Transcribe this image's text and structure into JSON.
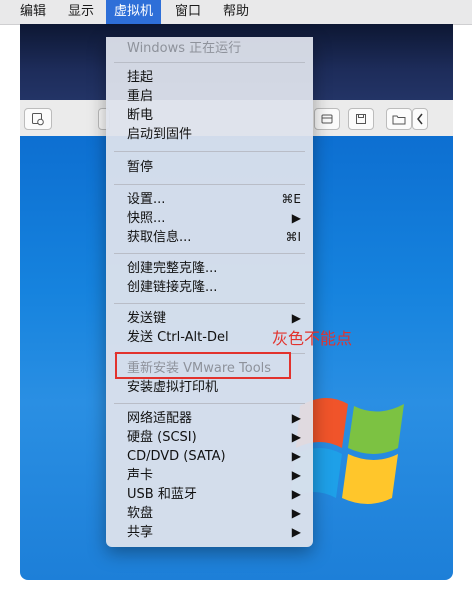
{
  "menubar": {
    "items": [
      {
        "label": "编辑"
      },
      {
        "label": "显示"
      },
      {
        "label": "虚拟机"
      },
      {
        "label": "窗口"
      },
      {
        "label": "帮助"
      }
    ]
  },
  "vm_menu": {
    "status": "Windows 正在运行",
    "items": [
      {
        "label": "挂起"
      },
      {
        "label": "重启"
      },
      {
        "label": "断电"
      },
      {
        "label": "启动到固件"
      },
      {
        "label": "暂停"
      },
      {
        "label": "设置...",
        "shortcut": "⌘E"
      },
      {
        "label": "快照...",
        "shortcut": "▶"
      },
      {
        "label": "获取信息...",
        "shortcut": "⌘I"
      },
      {
        "label": "创建完整克隆..."
      },
      {
        "label": "创建链接克隆..."
      },
      {
        "label": "发送键",
        "shortcut": "▶"
      },
      {
        "label": "发送 Ctrl-Alt-Del"
      },
      {
        "label": "重新安装 VMware Tools",
        "disabled": true
      },
      {
        "label": "安装虚拟打印机"
      },
      {
        "label": "网络适配器",
        "shortcut": "▶"
      },
      {
        "label": "硬盘 (SCSI)",
        "shortcut": "▶"
      },
      {
        "label": "CD/DVD (SATA)",
        "shortcut": "▶"
      },
      {
        "label": "声卡",
        "shortcut": "▶"
      },
      {
        "label": "USB 和蓝牙",
        "shortcut": "▶"
      },
      {
        "label": "软盘",
        "shortcut": "▶"
      },
      {
        "label": "共享",
        "shortcut": "▶"
      }
    ]
  },
  "annotation": {
    "text": "灰色不能点"
  },
  "colors": {
    "accent": "#2e6fd8",
    "annotation": "#e2322d"
  }
}
